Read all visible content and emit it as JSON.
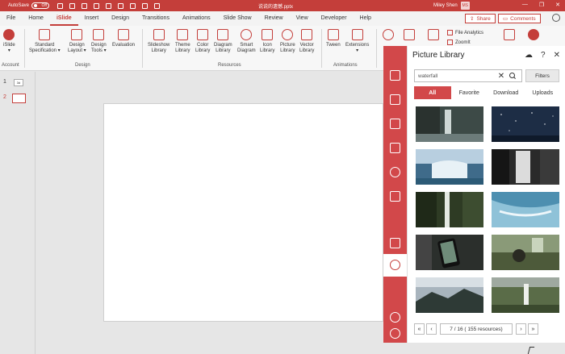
{
  "titlebar": {
    "autosave_label": "AutoSave",
    "autosave_state": "Off",
    "doc_title": "说说的遗憾.pptx",
    "user_name": "Miley Shen",
    "user_initials": "MS",
    "minimize": "—",
    "restore": "❐",
    "close": "✕"
  },
  "menu": {
    "tabs": [
      "File",
      "Home",
      "iSlide",
      "Insert",
      "Design",
      "Transitions",
      "Animations",
      "Slide Show",
      "Review",
      "View",
      "Developer",
      "Help"
    ],
    "active_index": 2,
    "share": "Share",
    "comments": "Comments"
  },
  "ribbon": {
    "account_label": "iSlide",
    "account_group": "Account",
    "design_buttons": [
      {
        "l1": "Standard",
        "l2": "Specification ▾"
      },
      {
        "l1": "Design",
        "l2": "Layout ▾"
      },
      {
        "l1": "Design",
        "l2": "Tools ▾"
      },
      {
        "l1": "Evaluation",
        "l2": ""
      }
    ],
    "design_group": "Design",
    "resource_buttons": [
      {
        "l1": "Slideshow",
        "l2": "Library"
      },
      {
        "l1": "Theme",
        "l2": "Library"
      },
      {
        "l1": "Color",
        "l2": "Library"
      },
      {
        "l1": "Diagram",
        "l2": "Library"
      },
      {
        "l1": "Smart",
        "l2": "Diagram"
      },
      {
        "l1": "Icon",
        "l2": "Library"
      },
      {
        "l1": "Picture",
        "l2": "Library"
      },
      {
        "l1": "Vector",
        "l2": "Library"
      }
    ],
    "resources_group": "Resources",
    "animation_buttons": [
      {
        "l1": "Tween",
        "l2": ""
      },
      {
        "l1": "Extensions",
        "l2": "▾"
      }
    ],
    "animations_group": "Animations",
    "file_analytics": "File Analytics",
    "zoomit": "ZoomIt"
  },
  "thumbnails": {
    "numbers": [
      "1",
      "2"
    ],
    "thumb1_text": "3d"
  },
  "panel": {
    "title": "Picture Library",
    "search_value": "waterfall",
    "clear": "✕",
    "filters": "Filters",
    "tabs": [
      "All",
      "Favorite",
      "Download",
      "Uploads"
    ],
    "active_tab": 0,
    "page_info": "7 / 16 ( 155 resources)",
    "first": "«",
    "prev": "‹",
    "next": "›",
    "last": "»"
  },
  "colors": {
    "brand": "#c43e3a",
    "sidebar": "#d2484a"
  }
}
